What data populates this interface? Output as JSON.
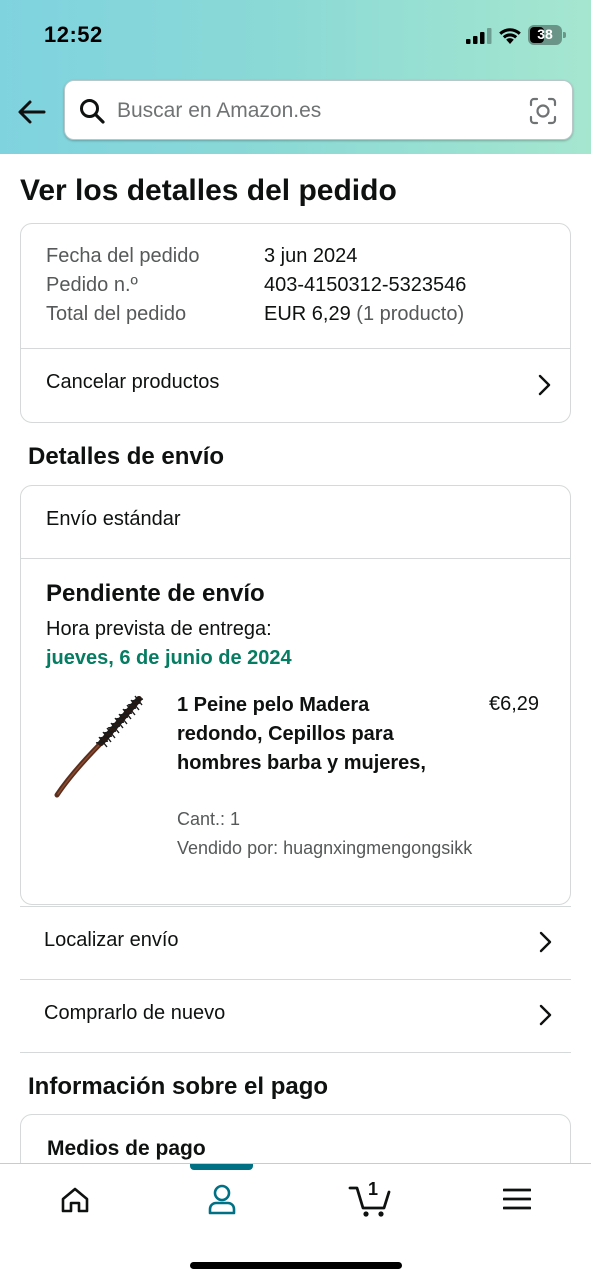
{
  "status_bar": {
    "time": "12:52",
    "battery": "38"
  },
  "search": {
    "placeholder": "Buscar en Amazon.es"
  },
  "page": {
    "title": "Ver los detalles del pedido"
  },
  "order_summary": {
    "rows": [
      {
        "label": "Fecha del pedido",
        "value": "3 jun 2024",
        "extra": ""
      },
      {
        "label": "Pedido n.º",
        "value": "403-4150312-5323546",
        "extra": ""
      },
      {
        "label": "Total del pedido",
        "value": "EUR 6,29",
        "extra": "(1 producto)"
      }
    ],
    "cancel_label": "Cancelar productos"
  },
  "shipping": {
    "section_title": "Detalles de envío",
    "type": "Envío estándar",
    "status_title": "Pendiente de envío",
    "delivery_label": "Hora prevista de entrega:",
    "delivery_date": "jueves, 6 de junio de 2024",
    "product": {
      "name": "1 Peine pelo Madera redondo, Cepillos para hombres barba y mujeres,",
      "price": "€6,29",
      "quantity": "Cant.: 1",
      "seller": "Vendido por: huagnxingmengongsikk"
    }
  },
  "actions": {
    "track_label": "Localizar envío",
    "buy_again_label": "Comprarlo de nuevo"
  },
  "payment": {
    "section_title": "Información sobre el pago",
    "methods_label": "Medios de pago"
  },
  "bottom_nav": {
    "items": [
      "home-icon",
      "account-icon",
      "cart-icon",
      "menu-icon"
    ],
    "active": "account-icon",
    "cart_count": "1"
  },
  "colors": {
    "accent": "#007185",
    "delivery_green": "#067d62",
    "header_gradient_start": "#7fd3df",
    "header_gradient_end": "#a5e6cf"
  }
}
